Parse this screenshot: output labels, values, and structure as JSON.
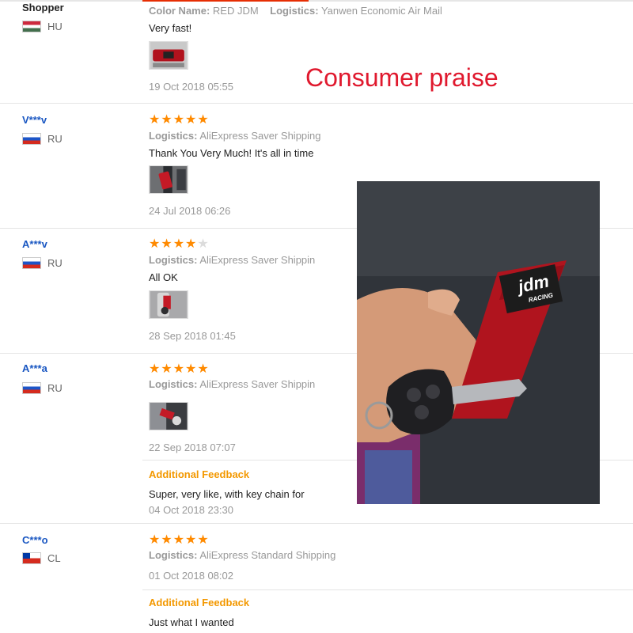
{
  "annotation": "Consumer praise",
  "labels": {
    "color_name": "Color Name:",
    "logistics": "Logistics:",
    "additional_feedback": "Additional Feedback"
  },
  "reviews": [
    {
      "user": "Shopper",
      "country": "HU",
      "color_value": "RED JDM",
      "logistics_value": "Yanwen Economic Air Mail",
      "text": "Very fast!",
      "date": "19 Oct 2018 05:55"
    },
    {
      "user": "V***v",
      "country": "RU",
      "stars": 5,
      "logistics_value": "AliExpress Saver Shipping",
      "text": "Thank You Very Much! It's all in time",
      "date": "24 Jul 2018 06:26"
    },
    {
      "user": "A***v",
      "country": "RU",
      "stars": 4,
      "logistics_value": "AliExpress Saver Shippin",
      "text": "All OK",
      "date": "28 Sep 2018 01:45"
    },
    {
      "user": "A***a",
      "country": "RU",
      "stars": 5,
      "logistics_value": "AliExpress Saver Shippin",
      "date": "22 Sep 2018 07:07",
      "additional_text": "Super, very like, with key chain for",
      "additional_date": "04 Oct 2018 23:30"
    },
    {
      "user": "C***o",
      "country": "CL",
      "stars": 5,
      "logistics_value": "AliExpress Standard Shipping",
      "date": "01 Oct 2018 08:02",
      "additional_text": "Just what I wanted"
    }
  ],
  "photo": {
    "strap_label_1": "jdm",
    "strap_label_2": "RACING"
  },
  "colors": {
    "star": "#ff8a00",
    "username": "#1a57c2",
    "feedback_heading": "#f39800",
    "annotation": "#e0192e"
  },
  "icons": [
    "star-icon",
    "flag-hu-icon",
    "flag-ru-icon",
    "flag-cl-icon"
  ]
}
